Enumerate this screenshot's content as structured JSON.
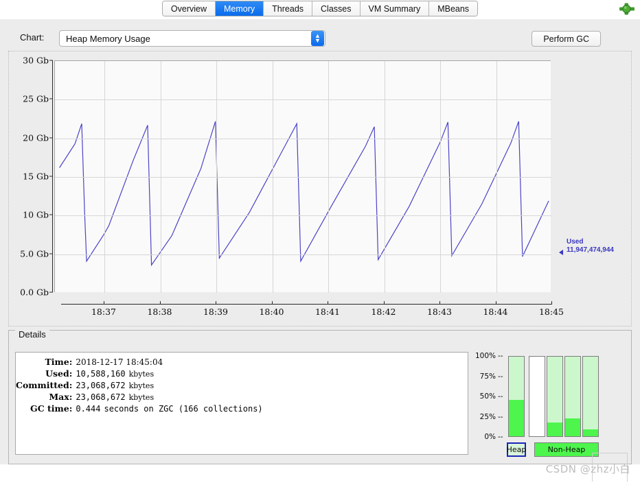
{
  "window": {
    "icon": "green-expand-icon"
  },
  "tabs": [
    {
      "label": "Overview",
      "selected": false
    },
    {
      "label": "Memory",
      "selected": true
    },
    {
      "label": "Threads",
      "selected": false
    },
    {
      "label": "Classes",
      "selected": false
    },
    {
      "label": "VM Summary",
      "selected": false
    },
    {
      "label": "MBeans",
      "selected": false
    }
  ],
  "toolbar": {
    "chart_label": "Chart:",
    "chart_selected": "Heap Memory Usage",
    "perform_gc_label": "Perform GC"
  },
  "chart_data": {
    "type": "line",
    "title": "Heap Memory Usage",
    "xlabel": "",
    "ylabel": "",
    "grid": true,
    "legend_position": "right",
    "ylim": [
      0,
      30
    ],
    "yunit": "Gb",
    "yticks": [
      "0.0 Gb",
      "5.0 Gb",
      "10 Gb",
      "15 Gb",
      "20 Gb",
      "25 Gb",
      "30 Gb"
    ],
    "ytick_values": [
      0,
      5,
      10,
      15,
      20,
      25,
      30
    ],
    "xticks": [
      "18:37",
      "18:38",
      "18:39",
      "18:40",
      "18:41",
      "18:42",
      "18:43",
      "18:44",
      "18:45"
    ],
    "xlim": [
      "18:36:40",
      "18:45:04"
    ],
    "series": [
      {
        "name": "Used",
        "color": "#4a43c8",
        "annotation_label": "Used",
        "annotation_value": "11,947,474,944",
        "points": [
          {
            "t": "18:36:39",
            "v": 16.2
          },
          {
            "t": "18:36:55",
            "v": 19.3
          },
          {
            "t": "18:37:02",
            "v": 21.9
          },
          {
            "t": "18:37:05",
            "v": 10.2
          },
          {
            "t": "18:37:07",
            "v": 4.1
          },
          {
            "t": "18:37:25",
            "v": 7.6
          },
          {
            "t": "18:37:30",
            "v": 8.7
          },
          {
            "t": "18:37:55",
            "v": 17.1
          },
          {
            "t": "18:38:10",
            "v": 21.7
          },
          {
            "t": "18:38:14",
            "v": 3.6
          },
          {
            "t": "18:38:35",
            "v": 7.4
          },
          {
            "t": "18:39:05",
            "v": 16.1
          },
          {
            "t": "18:39:20",
            "v": 22.2
          },
          {
            "t": "18:39:24",
            "v": 4.5
          },
          {
            "t": "18:39:55",
            "v": 10.4
          },
          {
            "t": "18:40:30",
            "v": 18.6
          },
          {
            "t": "18:40:44",
            "v": 21.9
          },
          {
            "t": "18:40:48",
            "v": 4.1
          },
          {
            "t": "18:41:20",
            "v": 11.3
          },
          {
            "t": "18:41:55",
            "v": 19.0
          },
          {
            "t": "18:42:04",
            "v": 21.5
          },
          {
            "t": "18:42:08",
            "v": 4.3
          },
          {
            "t": "18:42:40",
            "v": 11.2
          },
          {
            "t": "18:43:12",
            "v": 19.5
          },
          {
            "t": "18:43:20",
            "v": 22.1
          },
          {
            "t": "18:43:24",
            "v": 4.8
          },
          {
            "t": "18:43:55",
            "v": 11.5
          },
          {
            "t": "18:44:25",
            "v": 19.4
          },
          {
            "t": "18:44:33",
            "v": 22.2
          },
          {
            "t": "18:44:37",
            "v": 4.7
          },
          {
            "t": "18:45:04",
            "v": 11.9
          }
        ]
      }
    ]
  },
  "details": {
    "legend": "Details",
    "rows": [
      {
        "key": "Time:",
        "value": "2018-12-17 18:45:04",
        "unit": "",
        "style": "serif"
      },
      {
        "key": "Used:",
        "value": "10,588,160",
        "unit": "kbytes",
        "style": "mono"
      },
      {
        "key": "Committed:",
        "value": "23,068,672",
        "unit": "kbytes",
        "style": "mono"
      },
      {
        "key": "Max:",
        "value": "23,068,672",
        "unit": "kbytes",
        "style": "mono"
      },
      {
        "key": "GC time:",
        "value": "0.444",
        "unit": "seconds on ZGC (166 collections)",
        "style": "mono"
      }
    ]
  },
  "pools": {
    "axis_labels": [
      "100%",
      "75%",
      "50%",
      "25%",
      "0%"
    ],
    "axis_values": [
      100,
      75,
      50,
      25,
      0
    ],
    "dash": "--",
    "bars": [
      {
        "group": "heap",
        "percent": 46
      },
      {
        "group": "nonheap",
        "percent": 0
      },
      {
        "group": "nonheap",
        "percent": 17
      },
      {
        "group": "nonheap",
        "percent": 22
      },
      {
        "group": "nonheap",
        "percent": 9
      }
    ],
    "heap_button": "Heap",
    "nonheap_button": "Non-Heap",
    "fill_color": "#4df54d",
    "track_color": "#ccf7cc"
  },
  "watermark": {
    "text": "CSDN @zhz小白"
  }
}
